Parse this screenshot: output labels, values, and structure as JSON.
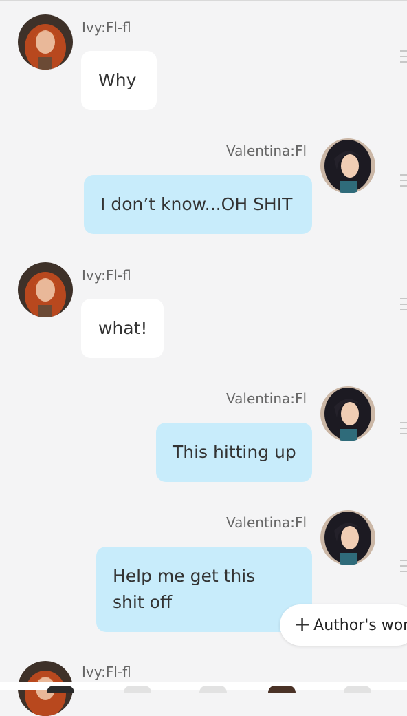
{
  "chat": {
    "messages": [
      {
        "sender": "Ivy:Fl-fl",
        "text": "Why",
        "side": "in",
        "avatar": "ivy-avatar"
      },
      {
        "sender": "Valentina:Fl",
        "text": "I don’t know...OH SHIT",
        "side": "out",
        "avatar": "valentina-avatar"
      },
      {
        "sender": "Ivy:Fl-fl",
        "text": "what!",
        "side": "in",
        "avatar": "ivy-avatar"
      },
      {
        "sender": "Valentina:Fl",
        "text": "This hitting up",
        "side": "out",
        "avatar": "valentina-avatar"
      },
      {
        "sender": "Valentina:Fl",
        "text": "Help me get this shit off",
        "side": "out",
        "avatar": "valentina-avatar"
      },
      {
        "sender": "Ivy:Fl-fl",
        "text": "",
        "side": "in",
        "avatar": "ivy-avatar"
      }
    ]
  },
  "author_button": {
    "icon": "plus-icon",
    "label": "Author's wor"
  },
  "colors": {
    "background": "#f4f4f5",
    "incoming_bubble": "#ffffff",
    "outgoing_bubble": "#c8ecfb",
    "name_text": "#666666"
  }
}
